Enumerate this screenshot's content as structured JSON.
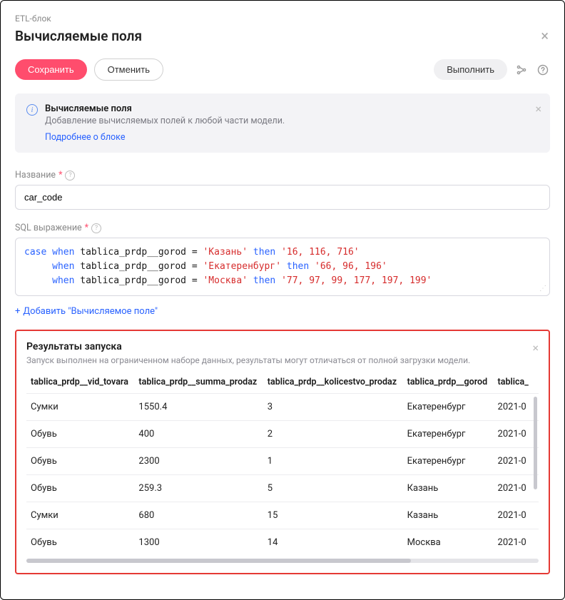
{
  "breadcrumb": "ETL-блок",
  "page_title": "Вычисляемые поля",
  "toolbar": {
    "save": "Сохранить",
    "cancel": "Отменить",
    "run": "Выполнить"
  },
  "info": {
    "title": "Вычисляемые поля",
    "desc": "Добавление вычисляемых полей к любой части модели.",
    "link": "Подробнее о блоке"
  },
  "fields": {
    "name_label": "Название",
    "name_value": "car_code",
    "sql_label": "SQL выражение",
    "sql_tokens": [
      {
        "t": "kw",
        "v": "case"
      },
      {
        "t": "sp",
        "v": " "
      },
      {
        "t": "kw",
        "v": "when"
      },
      {
        "t": "txt",
        "v": " tablica_prdp__gorod = "
      },
      {
        "t": "str",
        "v": "'Казань'"
      },
      {
        "t": "sp",
        "v": " "
      },
      {
        "t": "kw",
        "v": "then"
      },
      {
        "t": "sp",
        "v": " "
      },
      {
        "t": "str",
        "v": "'16, 116, 716'"
      },
      {
        "t": "nl"
      },
      {
        "t": "indent",
        "v": "     "
      },
      {
        "t": "kw",
        "v": "when"
      },
      {
        "t": "txt",
        "v": " tablica_prdp__gorod = "
      },
      {
        "t": "str",
        "v": "'Екатеренбург'"
      },
      {
        "t": "sp",
        "v": " "
      },
      {
        "t": "kw",
        "v": "then"
      },
      {
        "t": "sp",
        "v": " "
      },
      {
        "t": "str",
        "v": "'66, 96, 196'"
      },
      {
        "t": "nl"
      },
      {
        "t": "indent",
        "v": "     "
      },
      {
        "t": "kw",
        "v": "when"
      },
      {
        "t": "txt",
        "v": " tablica_prdp__gorod = "
      },
      {
        "t": "str",
        "v": "'Москва'"
      },
      {
        "t": "sp",
        "v": " "
      },
      {
        "t": "kw",
        "v": "then"
      },
      {
        "t": "sp",
        "v": " "
      },
      {
        "t": "str",
        "v": "'77, 97, 99, 177, 197, 199'"
      }
    ]
  },
  "add_link": "Добавить \"Вычисляемое поле\"",
  "results": {
    "title": "Результаты запуска",
    "note": "Запуск выполнен на ограниченном наборе данных, результаты могут отличаться от полной загрузки модели.",
    "columns": [
      "tablica_prdp__vid_tovara",
      "tablica_prdp__summa_prodaz",
      "tablica_prdp__kolicestvo_prodaz",
      "tablica_prdp__gorod",
      "tablica_"
    ],
    "rows": [
      [
        "Сумки",
        "1550.4",
        "3",
        "Екатеренбург",
        "2021-0"
      ],
      [
        "Обувь",
        "400",
        "2",
        "Екатеренбург",
        "2021-0"
      ],
      [
        "Обувь",
        "2300",
        "1",
        "Екатеренбург",
        "2021-0"
      ],
      [
        "Обувь",
        "259.3",
        "5",
        "Казань",
        "2021-0"
      ],
      [
        "Сумки",
        "680",
        "15",
        "Казань",
        "2021-0"
      ],
      [
        "Обувь",
        "1300",
        "14",
        "Москва",
        "2021-0"
      ]
    ]
  }
}
